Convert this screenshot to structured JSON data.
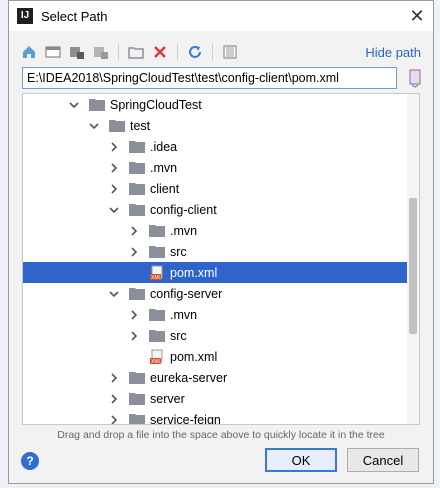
{
  "window": {
    "title": "Select Path",
    "app_icon_text": "IJ"
  },
  "toolbar": {
    "buttons": [
      "home-icon",
      "desktop-icon",
      "project-icon",
      "module-icon",
      "new-folder-icon",
      "delete-icon",
      "refresh-icon",
      "show-hidden-icon"
    ],
    "hide_path_label": "Hide path"
  },
  "path": {
    "value": "E:\\IDEA2018\\SpringCloudTest\\test\\config-client\\pom.xml"
  },
  "tree": {
    "items": [
      {
        "label": "SpringCloudTest",
        "depth": 0,
        "expanded": true,
        "type": "folder"
      },
      {
        "label": "test",
        "depth": 1,
        "expanded": true,
        "type": "folder"
      },
      {
        "label": ".idea",
        "depth": 2,
        "expanded": false,
        "type": "folder"
      },
      {
        "label": ".mvn",
        "depth": 2,
        "expanded": false,
        "type": "folder"
      },
      {
        "label": "client",
        "depth": 2,
        "expanded": false,
        "type": "folder"
      },
      {
        "label": "config-client",
        "depth": 2,
        "expanded": true,
        "type": "folder"
      },
      {
        "label": ".mvn",
        "depth": 3,
        "expanded": false,
        "type": "folder"
      },
      {
        "label": "src",
        "depth": 3,
        "expanded": false,
        "type": "folder"
      },
      {
        "label": "pom.xml",
        "depth": 3,
        "selected": true,
        "type": "file"
      },
      {
        "label": "config-server",
        "depth": 2,
        "expanded": true,
        "type": "folder"
      },
      {
        "label": ".mvn",
        "depth": 3,
        "expanded": false,
        "type": "folder"
      },
      {
        "label": "src",
        "depth": 3,
        "expanded": false,
        "type": "folder"
      },
      {
        "label": "pom.xml",
        "depth": 3,
        "type": "file"
      },
      {
        "label": "eureka-server",
        "depth": 2,
        "expanded": false,
        "type": "folder"
      },
      {
        "label": "server",
        "depth": 2,
        "expanded": false,
        "type": "folder"
      },
      {
        "label": "service-feign",
        "depth": 2,
        "expanded": false,
        "type": "folder"
      }
    ]
  },
  "hint": "Drag and drop a file into the space above to quickly locate it in the tree",
  "buttons": {
    "help": "?",
    "ok": "OK",
    "cancel": "Cancel"
  },
  "colors": {
    "selection": "#2f65ca",
    "link": "#2a64c4",
    "folder": "#8a8f99",
    "delete": "#d63b3b",
    "refresh": "#3a7ad8"
  }
}
